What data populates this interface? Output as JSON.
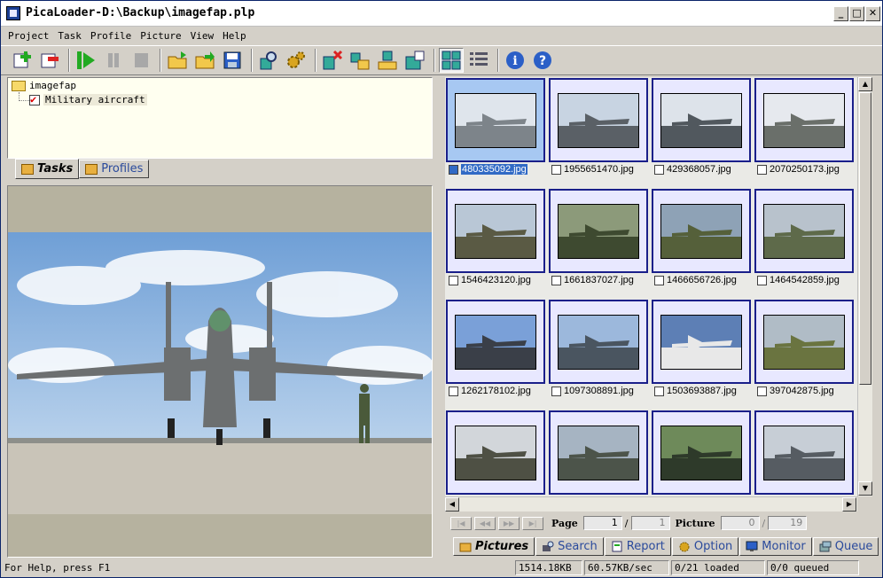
{
  "window": {
    "title": "PicaLoader-D:\\Backup\\imagefap.plp",
    "minimize": "_",
    "maximize": "□",
    "close": "✕"
  },
  "menu": [
    "Project",
    "Task",
    "Profile",
    "Picture",
    "View",
    "Help"
  ],
  "toolbar_icons": [
    "new-project-icon",
    "remove-project-icon",
    "start-icon",
    "pause-icon",
    "stop-icon",
    "open-folder-icon",
    "export-icon",
    "save-icon",
    "search-icon",
    "settings-icon",
    "delete-icon",
    "move-up-icon",
    "move-down-icon",
    "properties-icon",
    "thumbnail-view-icon",
    "list-view-icon",
    "info-icon",
    "help-icon"
  ],
  "tree": {
    "root": "imagefap",
    "child": "Military aircraft"
  },
  "left_tabs": [
    "Tasks",
    "Profiles"
  ],
  "thumbnails": [
    {
      "file": "480335092.jpg",
      "selected": true
    },
    {
      "file": "1955651470.jpg"
    },
    {
      "file": "429368057.jpg"
    },
    {
      "file": "2070250173.jpg"
    },
    {
      "file": "1546423120.jpg"
    },
    {
      "file": "1661837027.jpg"
    },
    {
      "file": "1466656726.jpg"
    },
    {
      "file": "1464542859.jpg"
    },
    {
      "file": "1262178102.jpg"
    },
    {
      "file": "1097308891.jpg"
    },
    {
      "file": "1503693887.jpg"
    },
    {
      "file": "397042875.jpg"
    },
    {
      "file": ""
    },
    {
      "file": ""
    },
    {
      "file": ""
    },
    {
      "file": ""
    }
  ],
  "pager": {
    "page_label": "Page",
    "page": "1",
    "sep": "/",
    "pages": "1",
    "picture_label": "Picture",
    "picture": "0",
    "pictures": "19"
  },
  "right_tabs": [
    "Pictures",
    "Search",
    "Report",
    "Option",
    "Monitor",
    "Queue"
  ],
  "status": {
    "help": "For Help, press F1",
    "size": "1514.18KB",
    "speed": "60.57KB/sec",
    "loaded": "0/21 loaded",
    "queued": "0/0 queued"
  },
  "colors": {
    "selection": "#316ac5",
    "thumb_border": "#1a1f8a",
    "tree_bg": "#fffff0"
  }
}
